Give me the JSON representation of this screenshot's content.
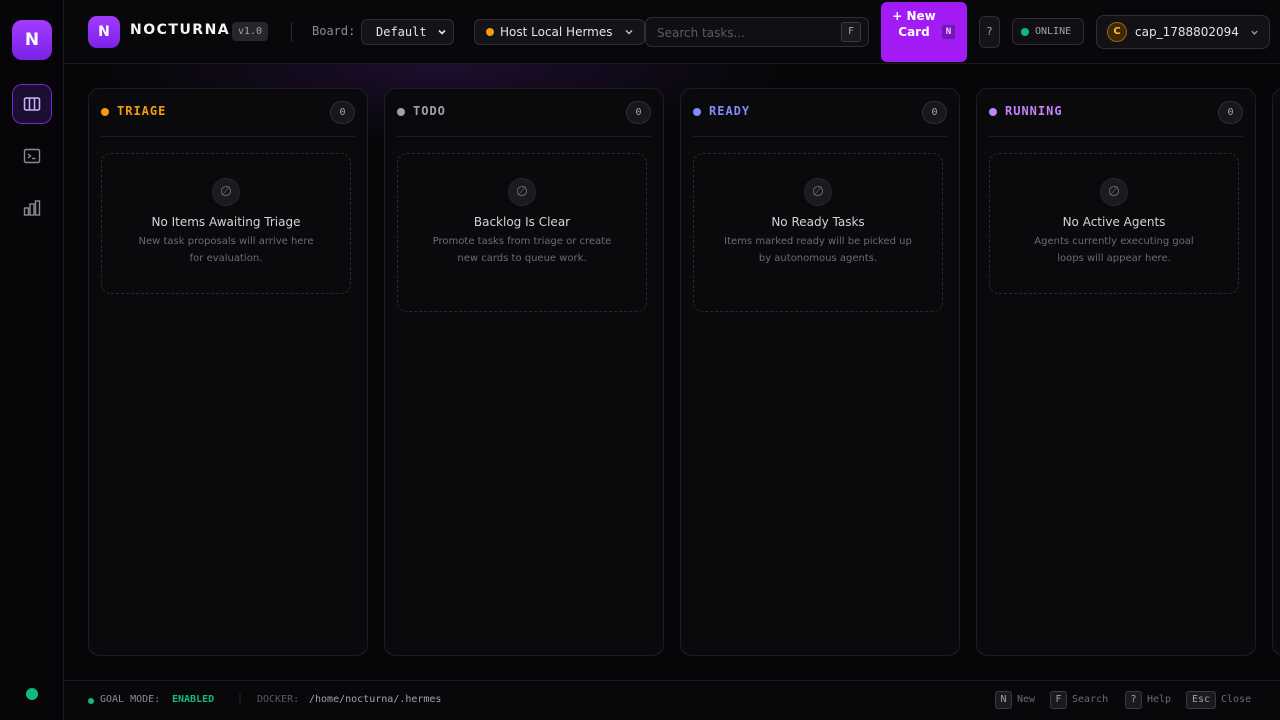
{
  "rail": {
    "logo": "N",
    "items": [
      {
        "name": "board-icon",
        "active": true
      },
      {
        "name": "terminal-icon",
        "active": false
      },
      {
        "name": "chart-icon",
        "active": false
      }
    ],
    "status_color": "#10b981"
  },
  "header": {
    "logo": "N",
    "brand": "NOCTURNA",
    "version": "v1.0",
    "board_label": "Board:",
    "board_value": "Default",
    "host_value": "Host Local Hermes",
    "host_status_color": "#f59e0b",
    "search_placeholder": "Search tasks...",
    "search_shortcut": "F",
    "new_card_label": "+ New Card",
    "new_card_shortcut": "N",
    "help_label": "?",
    "connection_status": "ONLINE",
    "user_initial": "C",
    "user_name": "cap_1788802094"
  },
  "columns": [
    {
      "title": "TRIAGE",
      "count": "0",
      "color": "#f59e0b",
      "empty_title": "No Items Awaiting Triage",
      "empty_desc": "New task proposals will arrive here for evaluation."
    },
    {
      "title": "TODO",
      "count": "0",
      "color": "#a1a1aa",
      "empty_title": "Backlog Is Clear",
      "empty_desc": "Promote tasks from triage or create new cards to queue work."
    },
    {
      "title": "READY",
      "count": "0",
      "color": "#818cf8",
      "empty_title": "No Ready Tasks",
      "empty_desc": "Items marked ready will be picked up by autonomous agents."
    },
    {
      "title": "RUNNING",
      "count": "0",
      "color": "#c084fc",
      "empty_title": "No Active Agents",
      "empty_desc": "Agents currently executing goal loops will appear here."
    }
  ],
  "empty_icon": "∅",
  "footer": {
    "goal_label": "GOAL MODE:",
    "goal_value": "ENABLED",
    "separator": "|",
    "docker_label": "DOCKER:",
    "docker_path": "/home/nocturna/.hermes",
    "shortcuts": [
      {
        "key": "N",
        "label": "New"
      },
      {
        "key": "F",
        "label": "Search"
      },
      {
        "key": "?",
        "label": "Help"
      },
      {
        "key": "Esc",
        "label": "Close"
      }
    ]
  },
  "colors": {
    "accent": "#a21bf5",
    "online": "#10b981"
  }
}
